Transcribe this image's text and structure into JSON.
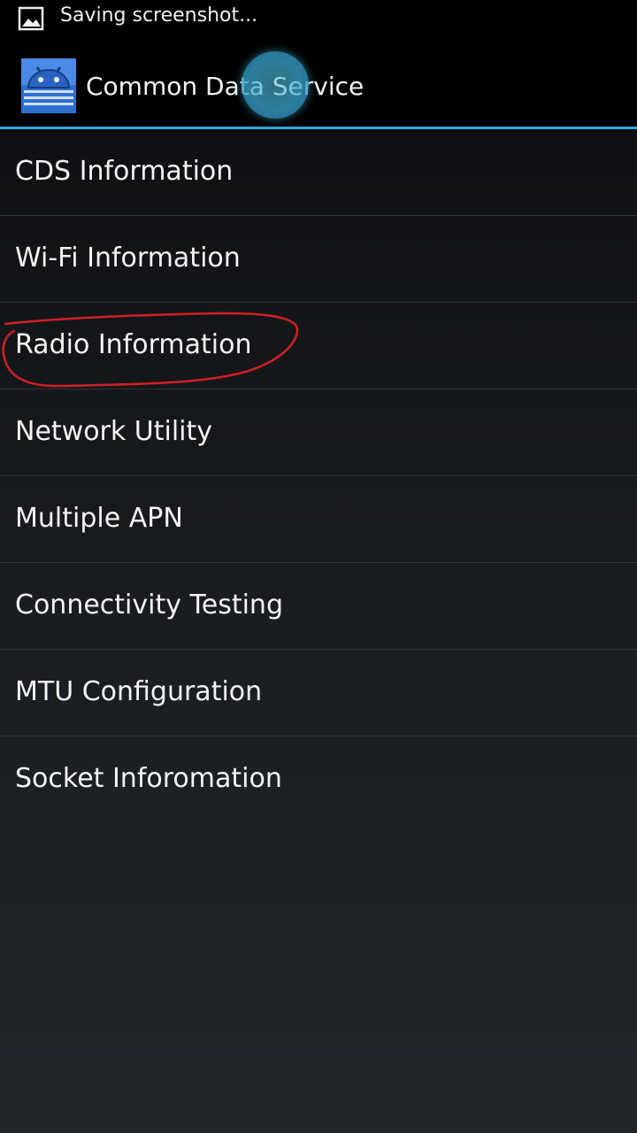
{
  "status_bar": {
    "notification_icon": "image-icon",
    "notification_text": "Saving screenshot..."
  },
  "action_bar": {
    "app_icon": "android-app-icon",
    "title": "Common Data Service",
    "accent_color": "#33a4d6"
  },
  "menu": {
    "items": [
      {
        "label": "CDS Information"
      },
      {
        "label": "Wi-Fi Information"
      },
      {
        "label": "Radio Information"
      },
      {
        "label": "Network Utility"
      },
      {
        "label": "Multiple APN"
      },
      {
        "label": "Connectivity Testing"
      },
      {
        "label": "MTU Configuration"
      },
      {
        "label": "Socket Inforomation"
      }
    ]
  },
  "annotation": {
    "color": "#d21f24",
    "highlighted_item": "Radio Information"
  }
}
